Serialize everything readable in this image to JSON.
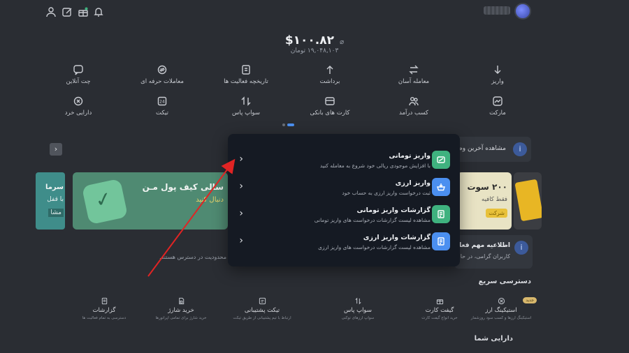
{
  "topbar": {
    "icons": [
      "user-icon",
      "edit-icon",
      "gift-icon",
      "bell-icon"
    ]
  },
  "balance": {
    "usd": "$۱۰۰.۸۲",
    "toman": "۱۹,۰۴۸,۱۰۳ تومان"
  },
  "actions_row1": [
    {
      "label": "واریز",
      "icon": "arrow-down-icon"
    },
    {
      "label": "معامله آسان",
      "icon": "swap-icon"
    },
    {
      "label": "برداشت",
      "icon": "arrow-up-icon"
    },
    {
      "label": "تاریخچه فعالیت ها",
      "icon": "document-icon"
    },
    {
      "label": "معاملات حرفه ای",
      "icon": "exchange-icon"
    },
    {
      "label": "چت آنلاین",
      "icon": "chat-icon"
    }
  ],
  "actions_row2": [
    {
      "label": "مارکت",
      "icon": "chart-icon"
    },
    {
      "label": "کسب درآمد",
      "icon": "users-icon"
    },
    {
      "label": "کارت های بانکی",
      "icon": "card-icon"
    },
    {
      "label": "سواپ پاس",
      "icon": "swap-vertical-icon"
    },
    {
      "label": "تیکت",
      "icon": "ticket-icon"
    },
    {
      "label": "دارایی خرد",
      "icon": "x-circle-icon"
    }
  ],
  "announce": {
    "text": "مشاهده آخرین وض",
    "title": "اطلاعیه مهم فعال",
    "desc": "کاربران گرامی، در حال"
  },
  "promos": {
    "green_title": "سالی کیف پول مـن",
    "green_sub": "دنبال کنید",
    "left_a": "سرما",
    "left_b": "با قفل",
    "left_c": "مشا",
    "yellow_a": "۲۰۰ سوت",
    "yellow_b": "فقط کافیه",
    "yellow_c": "شرکت"
  },
  "note": "محدودیت در دسترس هستند.",
  "sections": {
    "quick_access": "دسترسی سریع",
    "your_assets": "دارایی شما"
  },
  "quick": [
    {
      "title": "استیکینگ ارز",
      "sub": "استیکینگ ارزها و کسب سود روزشمار",
      "badge": "جدید",
      "icon": "stake-icon"
    },
    {
      "title": "گیفت کارت",
      "sub": "خرید انواع گیفت کارت",
      "icon": "gift-card-icon"
    },
    {
      "title": "سواپ پاس",
      "sub": "سواپ ارزهای توکنی",
      "icon": "swap-vertical-icon"
    },
    {
      "title": "تیکت پشتیبانی",
      "sub": "ارتباط با تیم پشتیبانی از طریق تیکت",
      "icon": "ticket-icon"
    },
    {
      "title": "خرید شارژ",
      "sub": "خرید شارژ برای تمامی اپراتورها",
      "icon": "sim-icon"
    },
    {
      "title": "گزارشات",
      "sub": "دسترسی به تمام فعالیت ها",
      "icon": "report-icon"
    }
  ],
  "modal": {
    "items": [
      {
        "title": "واریز تومانی",
        "sub": "با افزایش موجودی ریالی خود شروع به معامله کنید",
        "icon": "toman-deposit-icon",
        "color": "#3fb27f"
      },
      {
        "title": "واریز ارزی",
        "sub": "ثبت درخواست واریز ارزی به حساب خود",
        "icon": "crypto-deposit-icon",
        "color": "#4b8ff0"
      },
      {
        "title": "گزارشات واریز تومانی",
        "sub": "مشاهده لیست گزارشات درخواست های واریز تومانی",
        "icon": "toman-report-icon",
        "color": "#3fb27f"
      },
      {
        "title": "گزارشات واریز ارزی",
        "sub": "مشاهده لیست گزارشات درخواست های واریز ارزی",
        "icon": "crypto-report-icon",
        "color": "#4b8ff0"
      }
    ]
  },
  "colors": {
    "background": "#2a2d33",
    "modal": "#151a23",
    "accent_blue": "#4b8ff0",
    "accent_green": "#3fb27f",
    "annotation_arrow": "#e02424"
  }
}
